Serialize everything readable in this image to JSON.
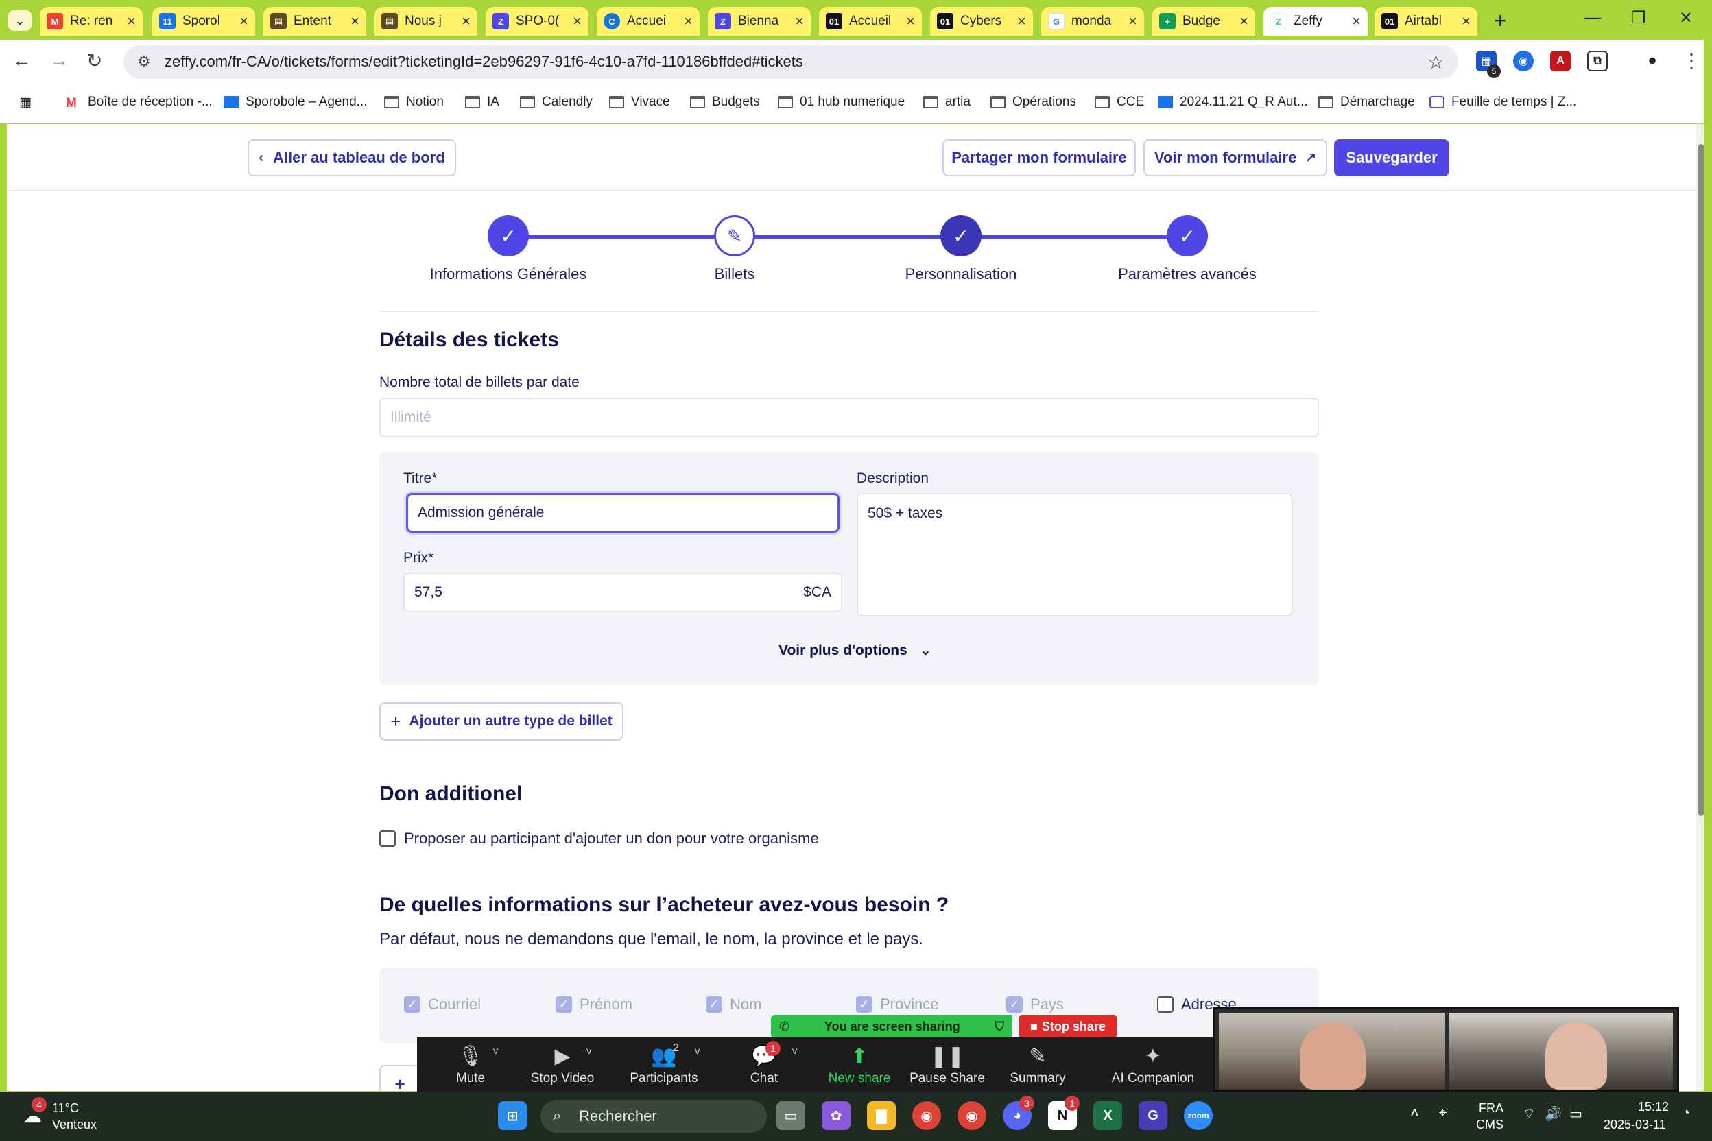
{
  "browser": {
    "tabs": [
      {
        "title": "Re: ren",
        "icon": "gmail-icon",
        "color": "#ea4335"
      },
      {
        "title": "Sporol",
        "icon": "calendar-icon",
        "color": "#1a73e8"
      },
      {
        "title": "Entent",
        "icon": "doc-icon",
        "color": "#5f4b1e"
      },
      {
        "title": "Nous j",
        "icon": "doc-icon",
        "color": "#5f4b1e"
      },
      {
        "title": "SPO-0(",
        "icon": "zeffy-icon",
        "color": "#4f46e5"
      },
      {
        "title": "Accuei",
        "icon": "circle-c-icon",
        "color": "#1976d2"
      },
      {
        "title": "Bienna",
        "icon": "zeffy-icon",
        "color": "#4f46e5"
      },
      {
        "title": "Accueil",
        "icon": "o1-icon",
        "color": "#111111"
      },
      {
        "title": "Cybers",
        "icon": "o1-icon",
        "color": "#111111"
      },
      {
        "title": "monda",
        "icon": "google-icon",
        "color": "#4285f4"
      },
      {
        "title": "Budge",
        "icon": "sheets-icon",
        "color": "#0f9d58"
      },
      {
        "title": "Zeffy",
        "icon": "zeffy-icon",
        "color": "#4f46e5",
        "active": true
      },
      {
        "title": "Airtabl",
        "icon": "o1-icon",
        "color": "#111111"
      }
    ],
    "url": "zeffy.com/fr-CA/o/tickets/forms/edit?ticketingId=2eb96297-91f6-4c10-a7fd-110186bffded#tickets",
    "extension_badge": "5",
    "bookmarks": [
      "Boîte de réception -...",
      "Sporobole – Agend...",
      "Notion",
      "IA",
      "Calendly",
      "Vivace",
      "Budgets",
      "01 hub numerique",
      "artia",
      "Opérations",
      "CCE",
      "2024.11.21 Q_R Aut...",
      "Démarchage",
      "Feuille de temps | Z..."
    ]
  },
  "header": {
    "back_label": "Aller au tableau de bord",
    "share_label": "Partager mon formulaire",
    "view_label": "Voir mon formulaire",
    "save_label": "Sauvegarder"
  },
  "steps": [
    {
      "label": "Informations Générales",
      "state": "done"
    },
    {
      "label": "Billets",
      "state": "current"
    },
    {
      "label": "Personnalisation",
      "state": "done"
    },
    {
      "label": "Paramètres avancés",
      "state": "done"
    }
  ],
  "tickets": {
    "section_title": "Détails des tickets",
    "total_label": "Nombre total de billets par date",
    "total_placeholder": "Illimité",
    "title_label": "Titre*",
    "title_value": "Admission générale",
    "description_label": "Description",
    "description_value": "50$ + taxes",
    "price_label": "Prix*",
    "price_value": "57,5",
    "currency": "$CA",
    "more_options": "Voir plus d'options",
    "add_ticket": "Ajouter un autre type de billet"
  },
  "donation": {
    "title": "Don additionel",
    "checkbox_label": "Proposer au participant d'ajouter un don pour votre organisme"
  },
  "buyer_info": {
    "title": "De quelles informations sur l’acheteur avez-vous besoin ?",
    "subtitle": "Par défaut, nous ne demandons que l'email, le nom, la province et le pays.",
    "fields": [
      {
        "label": "Courriel",
        "checked": true
      },
      {
        "label": "Prénom",
        "checked": true
      },
      {
        "label": "Nom",
        "checked": true
      },
      {
        "label": "Province",
        "checked": true
      },
      {
        "label": "Pays",
        "checked": true
      },
      {
        "label": "Adresse",
        "checked": false
      }
    ]
  },
  "zoom": {
    "sharing_text": "You are screen sharing",
    "stop_share": "Stop share",
    "items": [
      {
        "label": "Mute",
        "icon": "microphone-icon"
      },
      {
        "label": "Stop Video",
        "icon": "video-camera-icon"
      },
      {
        "label": "Participants",
        "icon": "participants-icon",
        "count": "2"
      },
      {
        "label": "Chat",
        "icon": "chat-icon",
        "badge": "1"
      },
      {
        "label": "New share",
        "icon": "share-screen-icon"
      },
      {
        "label": "Pause Share",
        "icon": "pause-icon"
      },
      {
        "label": "Summary",
        "icon": "summary-icon"
      },
      {
        "label": "AI Companion",
        "icon": "sparkle-icon"
      }
    ]
  },
  "taskbar": {
    "weather_temp": "11°C",
    "weather_desc": "Venteux",
    "weather_badge": "4",
    "search_placeholder": "Rechercher",
    "discord_badge": "3",
    "notion_badge": "1",
    "lang": "FRA",
    "lang_sub": "CMS",
    "time": "15:12",
    "date": "2025-03-11"
  },
  "colors": {
    "brand": "#4f46e5",
    "brand_dark": "#3b36b8",
    "heading": "#14144d",
    "chrome_frame": "#a8d53a"
  }
}
